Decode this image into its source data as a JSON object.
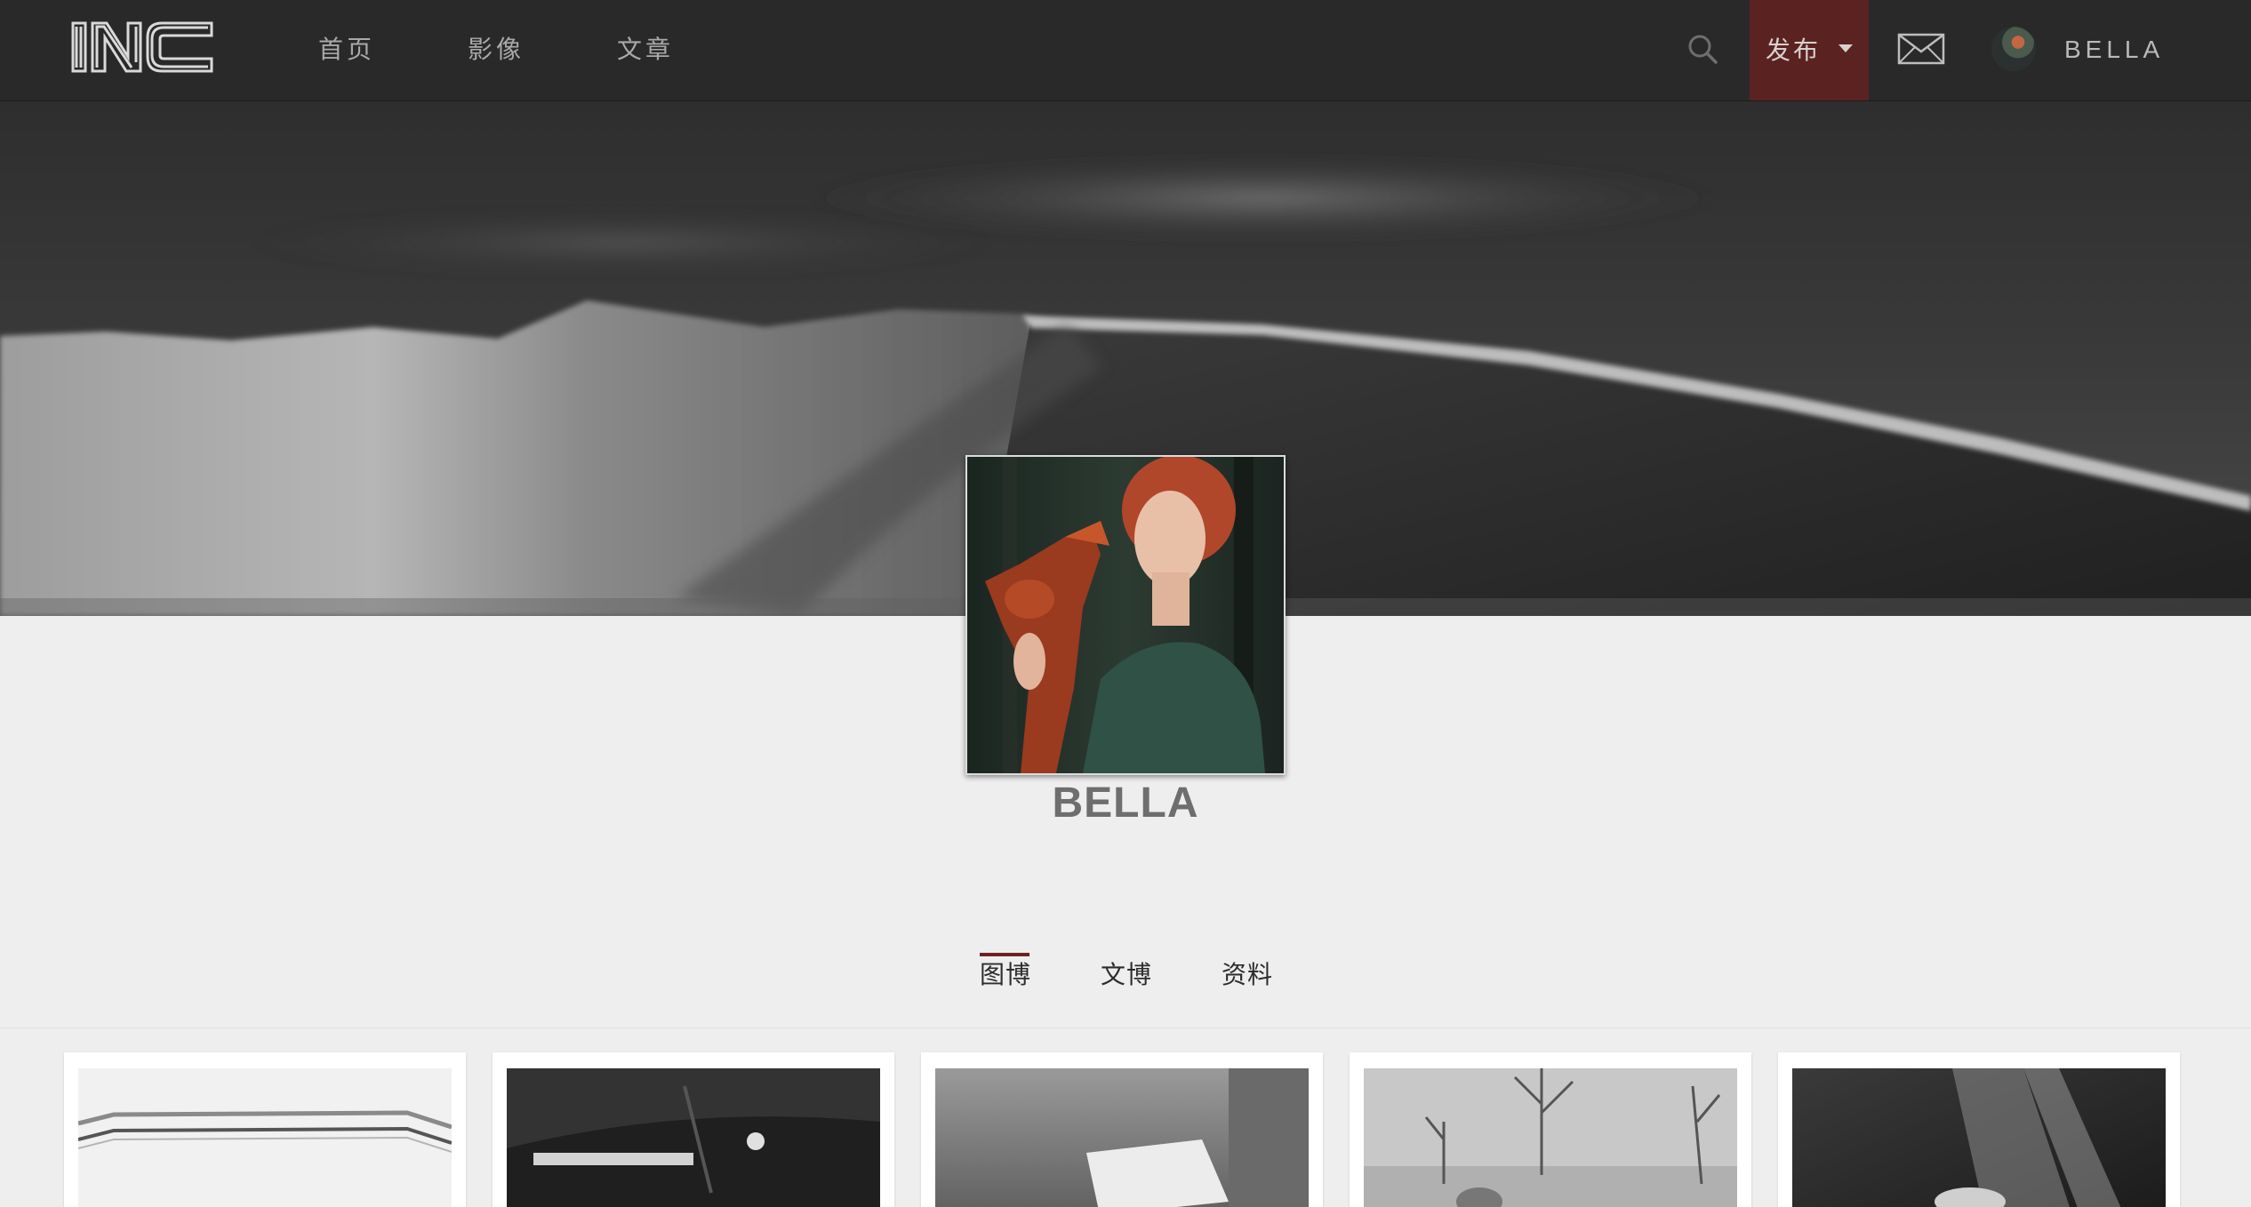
{
  "brand": {
    "logo_text": "INC"
  },
  "nav": {
    "links": [
      {
        "label": "首页"
      },
      {
        "label": "影像"
      },
      {
        "label": "文章"
      }
    ],
    "publish_label": "发布",
    "username": "BELLA"
  },
  "profile": {
    "name": "BELLA"
  },
  "tabs": [
    {
      "label": "图博",
      "active": true
    },
    {
      "label": "文博",
      "active": false
    },
    {
      "label": "资料",
      "active": false
    }
  ],
  "colors": {
    "navbar_bg": "#2a2929",
    "accent": "#5a2322",
    "tab_underline": "#6b2322",
    "page_bg": "#efeeef"
  },
  "icons": {
    "search": "search-icon",
    "publish_caret": "caret-down-icon",
    "mail": "mail-icon"
  },
  "gallery": {
    "items": [
      {
        "subject": "abstract-bw"
      },
      {
        "subject": "car-dark-bw"
      },
      {
        "subject": "letter-bw"
      },
      {
        "subject": "deer-forest-bw"
      },
      {
        "subject": "underwater-light-bw"
      }
    ]
  }
}
